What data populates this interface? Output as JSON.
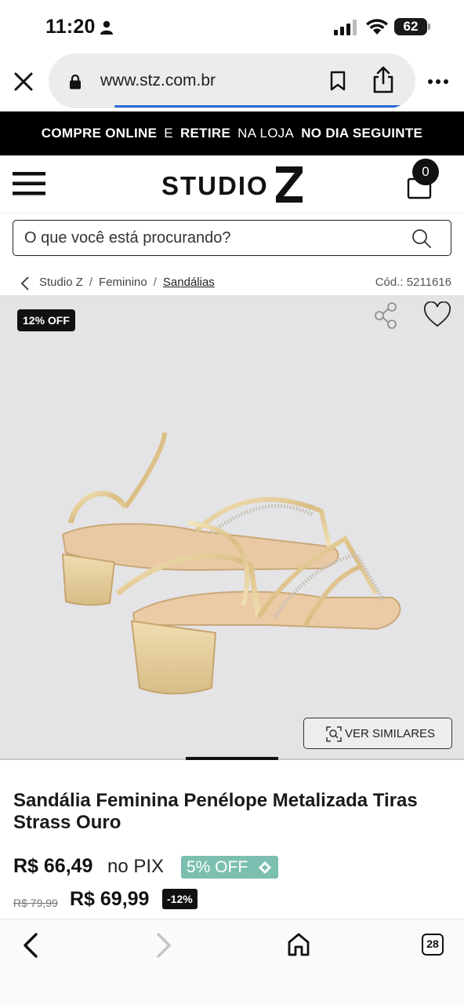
{
  "status_bar": {
    "time": "11:20",
    "battery": "62"
  },
  "browser": {
    "url": "www.stz.com.br",
    "load_progress": 0.85
  },
  "banner": {
    "part1": "COMPRE ONLINE",
    "part2": "E",
    "part3": "RETIRE",
    "part4": "NA LOJA",
    "part5": "NO DIA SEGUINTE"
  },
  "header": {
    "logo": "STUDIO Z",
    "cart_count": "0"
  },
  "search": {
    "placeholder": "O que você está procurando?"
  },
  "breadcrumb": {
    "items": [
      "Studio Z",
      "Feminino",
      "Sandálias"
    ],
    "separator": "/",
    "code": "Cód.: 5211616"
  },
  "gallery": {
    "discount_badge": "12% OFF",
    "similar_button": "VER SIMILARES",
    "image_index": 3,
    "image_count": 5
  },
  "product": {
    "title": "Sandália Feminina Penélope Metalizada Tiras Strass Ouro",
    "pix_price": "R$ 66,49",
    "pix_label": "no PIX",
    "pix_badge": "5% OFF",
    "old_price": "R$ 79,99",
    "price": "R$ 69,99",
    "discount": "-12%"
  },
  "toolbar": {
    "tabs_count": "28"
  },
  "colors": {
    "accent_pix": "#7cbfb0",
    "progress": "#2a6bd1",
    "banner_bg": "#000000"
  }
}
